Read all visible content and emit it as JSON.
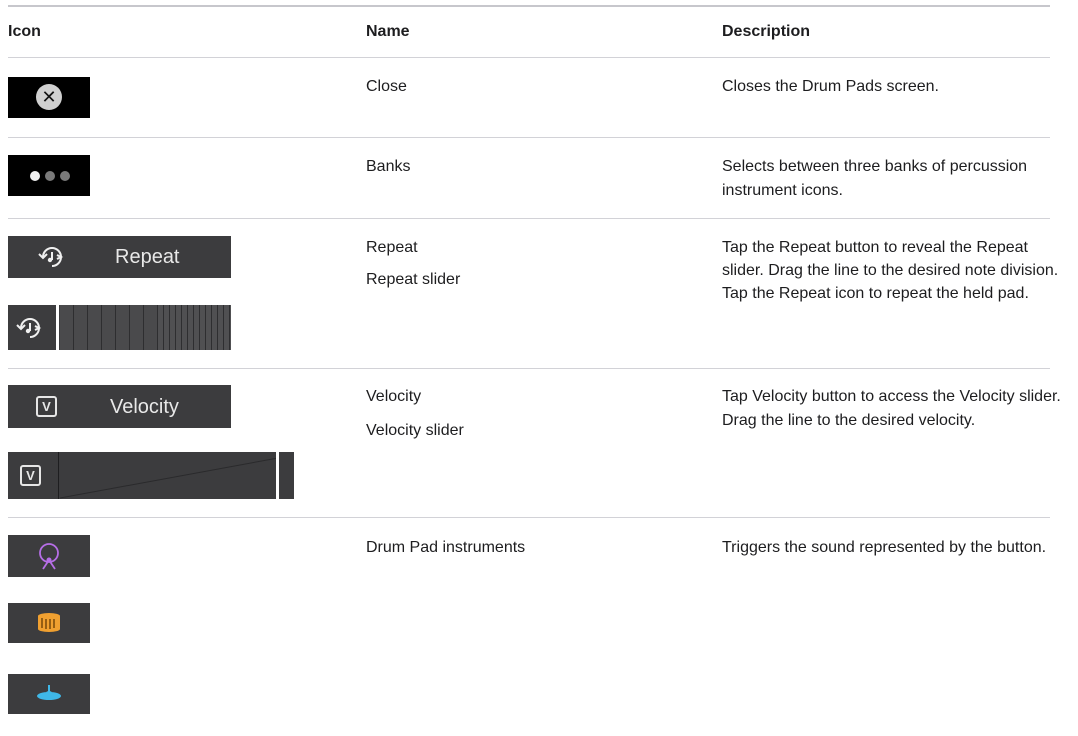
{
  "table": {
    "headers": {
      "icon": "Icon",
      "name": "Name",
      "description": "Description"
    },
    "rows": [
      {
        "name": "Close",
        "description": "Closes the Drum Pads screen."
      },
      {
        "name": "Banks",
        "description": "Selects between three banks of percussion instrument icons."
      },
      {
        "name": "Repeat",
        "name2": "Repeat slider",
        "description": "Tap the Repeat button to reveal the Repeat slider. Drag the line to the desired note division. Tap the Repeat icon to repeat the held pad.",
        "button_label": "Repeat"
      },
      {
        "name": "Velocity",
        "name2": "Velocity slider",
        "description": "Tap Velocity button to access the Velocity slider. Drag the line to the desired velocity.",
        "button_label": "Velocity",
        "icon_letter": "V"
      },
      {
        "name": "Drum Pad instruments",
        "description": "Triggers the sound represented by the button."
      }
    ]
  },
  "colors": {
    "kick_icon": "#b66ee6",
    "snare_icon": "#f0a030",
    "cymbal_icon": "#3fb8e8",
    "slider_bg": "#3c3c3e",
    "icon_bg": "#000000"
  },
  "icons": [
    "close-icon",
    "banks-dots-icon",
    "repeat-icon",
    "velocity-icon",
    "kick-drum-icon",
    "snare-drum-icon",
    "cymbal-icon"
  ]
}
